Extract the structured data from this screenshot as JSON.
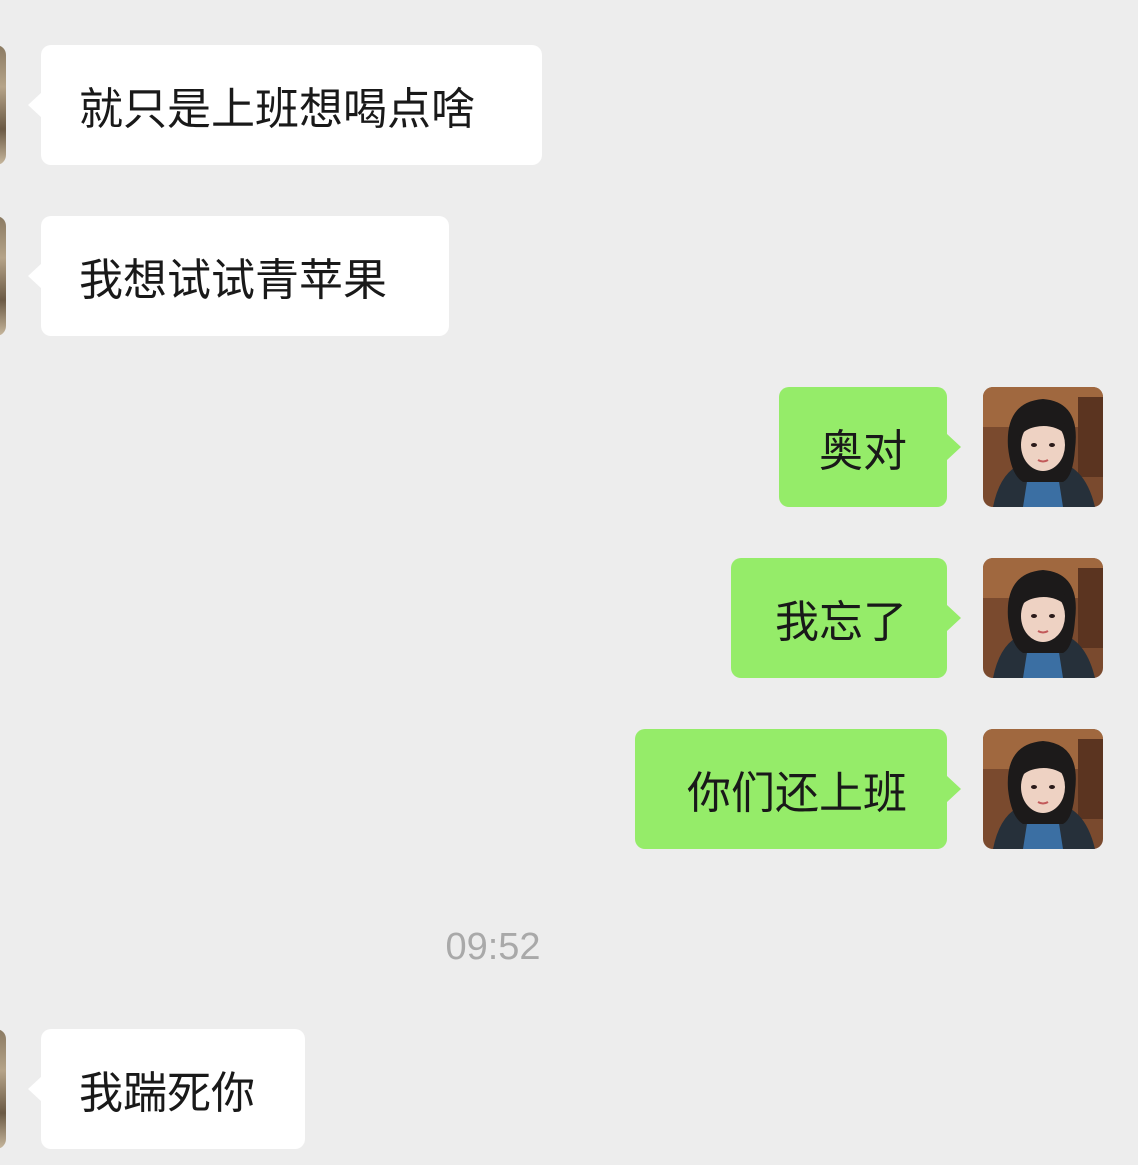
{
  "chat": {
    "messages": [
      {
        "side": "left",
        "text": "就只是上班想喝点啥"
      },
      {
        "side": "left",
        "text": "我想试试青苹果"
      },
      {
        "side": "right",
        "text": "奥对"
      },
      {
        "side": "right",
        "text": "我忘了"
      },
      {
        "side": "right",
        "text": "你们还上班"
      },
      {
        "side": "left",
        "text": "我踹死你"
      }
    ],
    "timestamp": "09:52"
  },
  "colors": {
    "background": "#ededed",
    "incoming_bubble": "#ffffff",
    "outgoing_bubble": "#95ec69",
    "timestamp_text": "#a9a9a9"
  },
  "icons": {
    "contact_avatar": "cropped-contact-avatar-photo",
    "self_avatar": "self-avatar-photo"
  }
}
